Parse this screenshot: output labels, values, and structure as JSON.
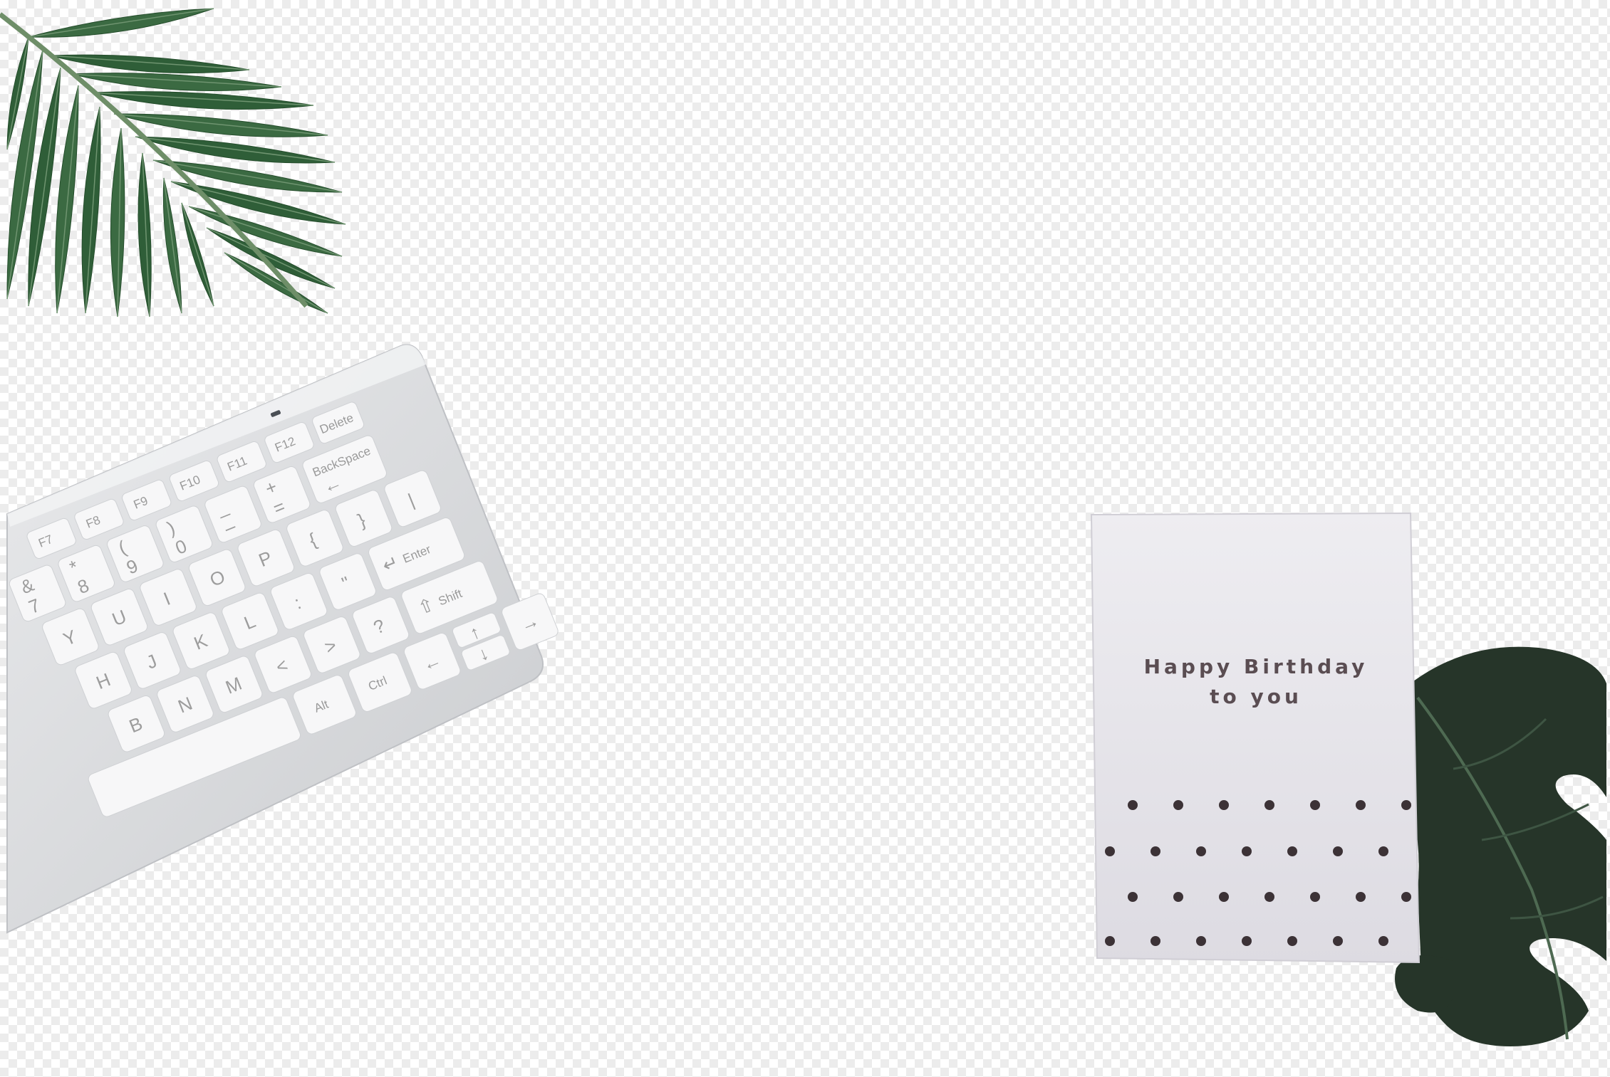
{
  "card": {
    "line1": "Happy Birthday",
    "line2": "to you"
  },
  "keyboard": {
    "function_keys": [
      "F7",
      "F8",
      "F9",
      "F10",
      "F11",
      "F12"
    ],
    "delete_label": "Delete",
    "backspace_label": "BackSpace",
    "enter_label": "Enter",
    "shift_label": "Shift",
    "ctrl_label": "Ctrl",
    "alt_label": "Alt",
    "row_number_keys": [
      "&",
      "*",
      "(",
      ")",
      "_",
      "+"
    ],
    "row_number_lower": [
      "7",
      "8",
      "9",
      "0",
      "–",
      "="
    ],
    "row_qwerty": [
      "Y",
      "U",
      "I",
      "O",
      "P",
      "{",
      "}",
      "|"
    ],
    "row_home": [
      "H",
      "J",
      "K",
      "L",
      ":",
      "\""
    ],
    "row_bottom": [
      "B",
      "N",
      "M",
      "<",
      ">",
      "?"
    ]
  },
  "colors": {
    "leaf_dark": "#2f5e38",
    "leaf_light": "#4f7f55",
    "monstera": "#253428",
    "keyboard_body": "#d9dadc",
    "key_face": "#f7f7f8",
    "card": "#e6e4ea",
    "dot": "#3c3236"
  }
}
